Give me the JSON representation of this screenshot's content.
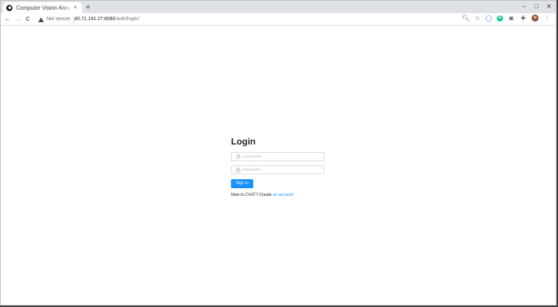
{
  "browser": {
    "tab": {
      "title": "Computer Vision Annotation Tool",
      "close_glyph": "×"
    },
    "new_tab_glyph": "+",
    "window_controls": {
      "minimize": "–",
      "maximize": "□",
      "close": "✕"
    },
    "nav": {
      "back": "←",
      "forward": "→",
      "reload": "C"
    },
    "security_label": "Not secure",
    "url": {
      "host": "40.71.191.27:8080",
      "path": "/auth/login/"
    }
  },
  "login": {
    "title": "Login",
    "username": {
      "placeholder": "Username",
      "value": ""
    },
    "password": {
      "placeholder": "Password",
      "value": ""
    },
    "submit_label": "Sign in",
    "signup_prompt": "New to CVAT? Create ",
    "signup_link": "an account"
  },
  "colors": {
    "primary": "#1890ff",
    "tabstrip": "#dee1e6",
    "title_text": "#262626"
  },
  "icons": {
    "tab_favicon": "cvat-logo-icon",
    "username_field": "user-icon",
    "password_field": "lock-icon",
    "toolbar": [
      "zoom-icon",
      "star-icon",
      "extension-circle-icon",
      "grammarly-icon",
      "camera-icon",
      "puzzle-icon",
      "avatar",
      "kebab-menu-icon"
    ]
  }
}
